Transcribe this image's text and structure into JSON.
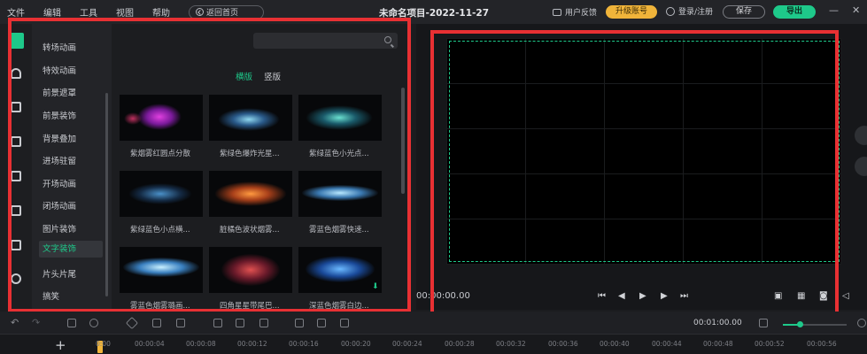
{
  "menu": [
    "文件",
    "编辑",
    "工具",
    "视图",
    "帮助"
  ],
  "home_button": "返回首页",
  "project_title": "未命名项目-2022-11-27",
  "header": {
    "feedback": "用户反馈",
    "upgrade": "升级账号",
    "login": "登录/注册",
    "save": "保存",
    "export": "导出"
  },
  "categories": [
    "转场动画",
    "特效动画",
    "前景遮罩",
    "前景装饰",
    "背景叠加",
    "进场驻留",
    "开场动画",
    "闭场动画",
    "图片装饰",
    "文字装饰",
    "片头片尾",
    "搞笑"
  ],
  "active_category": "文字装饰",
  "search": {
    "placeholder": ""
  },
  "tabs": [
    "横版",
    "竖版"
  ],
  "assets": [
    "紫烟雾红圆点分散",
    "紫绿色爆炸光星...",
    "紫绿蓝色小光点...",
    "紫绿蓝色小点横...",
    "脏橘色波状烟雾...",
    "雾蓝色烟雾快速...",
    "雾蓝色烟雾璐画...",
    "四角星星带尾巴...",
    "深蓝色烟雾白边..."
  ],
  "preview": {
    "timecode": "00:00:00.00"
  },
  "timeline": {
    "current_time": "00:01:00.00",
    "ticks": [
      "0:00",
      "00:00:04",
      "00:00:08",
      "00:00:12",
      "00:00:16",
      "00:00:20",
      "00:00:24",
      "00:00:28",
      "00:00:32",
      "00:00:36",
      "00:00:40",
      "00:00:44",
      "00:00:48",
      "00:00:52",
      "00:00:56"
    ]
  },
  "colors": {
    "accent": "#1ec98a",
    "upgrade": "#f0b43a",
    "highlight": "#e83033"
  }
}
